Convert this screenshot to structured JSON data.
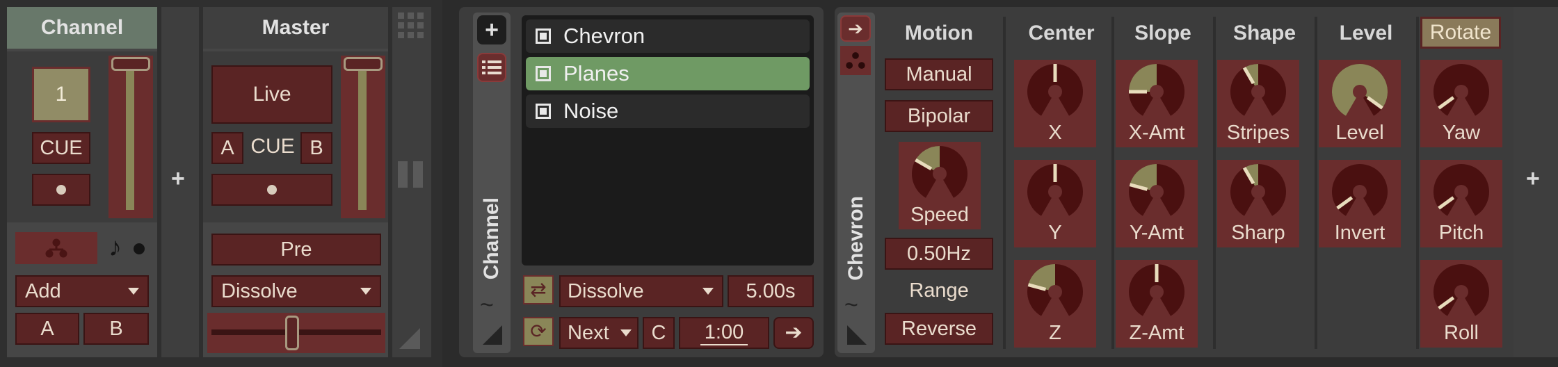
{
  "channel_strip": {
    "title": "Channel",
    "channel_number": "1",
    "cue_label": "CUE",
    "blend_mode": "Add",
    "a_label": "A",
    "b_label": "B",
    "fader_level": 1.0
  },
  "master_strip": {
    "title": "Master",
    "live_label": "Live",
    "a_label": "A",
    "cue_label": "CUE",
    "b_label": "B",
    "pre_label": "Pre",
    "transition": "Dissolve",
    "crossfader": 0.5,
    "fader_level": 1.0
  },
  "channel_panel": {
    "title": "Channel",
    "patterns": [
      {
        "name": "Chevron",
        "active": false
      },
      {
        "name": "Planes",
        "active": true
      },
      {
        "name": "Noise",
        "active": false
      }
    ],
    "transition": "Dissolve",
    "transition_time": "5.00s",
    "auto_cycle": "Next",
    "c_label": "C",
    "cycle_time": "1:00"
  },
  "device_panel": {
    "title": "Chevron",
    "motion": {
      "header": "Motion",
      "manual": "Manual",
      "bipolar": "Bipolar",
      "speed_label": "Speed",
      "speed_value": "0.50Hz",
      "range_label": "Range",
      "reverse": "Reverse"
    },
    "columns": [
      {
        "header": "Center",
        "knobs": [
          {
            "label": "X",
            "value": 0.5
          },
          {
            "label": "Y",
            "value": 0.5
          },
          {
            "label": "Z",
            "value": 0.25
          }
        ]
      },
      {
        "header": "Slope",
        "knobs": [
          {
            "label": "X-Amt",
            "value": 0.2
          },
          {
            "label": "Y-Amt",
            "value": 0.25
          },
          {
            "label": "Z-Amt",
            "value": 0.5
          }
        ]
      },
      {
        "header": "Shape",
        "knobs": [
          {
            "label": "Stripes",
            "value": 0.4
          },
          {
            "label": "Sharp",
            "value": 0.4
          }
        ]
      },
      {
        "header": "Level",
        "knobs": [
          {
            "label": "Level",
            "value": 0.92
          },
          {
            "label": "Invert",
            "value": 0.08
          }
        ]
      },
      {
        "header": "Rotate",
        "knobs": [
          {
            "label": "Yaw",
            "value": 0.08
          },
          {
            "label": "Pitch",
            "value": 0.08
          },
          {
            "label": "Roll",
            "value": 0.08
          }
        ]
      }
    ]
  },
  "colors": {
    "accent_green": "#6f9a64",
    "knob_fill": "#8a8658",
    "knob_base": "#4a1010",
    "button_bg": "#5a2424"
  },
  "icons": [
    "plus-icon",
    "list-icon",
    "grid-icon",
    "pause-icon",
    "resize-corner-icon",
    "arrow-right-icon",
    "swap-icon",
    "loop-icon",
    "tree-icon",
    "music-note-icon",
    "wave-icon",
    "dropdown-caret-icon"
  ]
}
